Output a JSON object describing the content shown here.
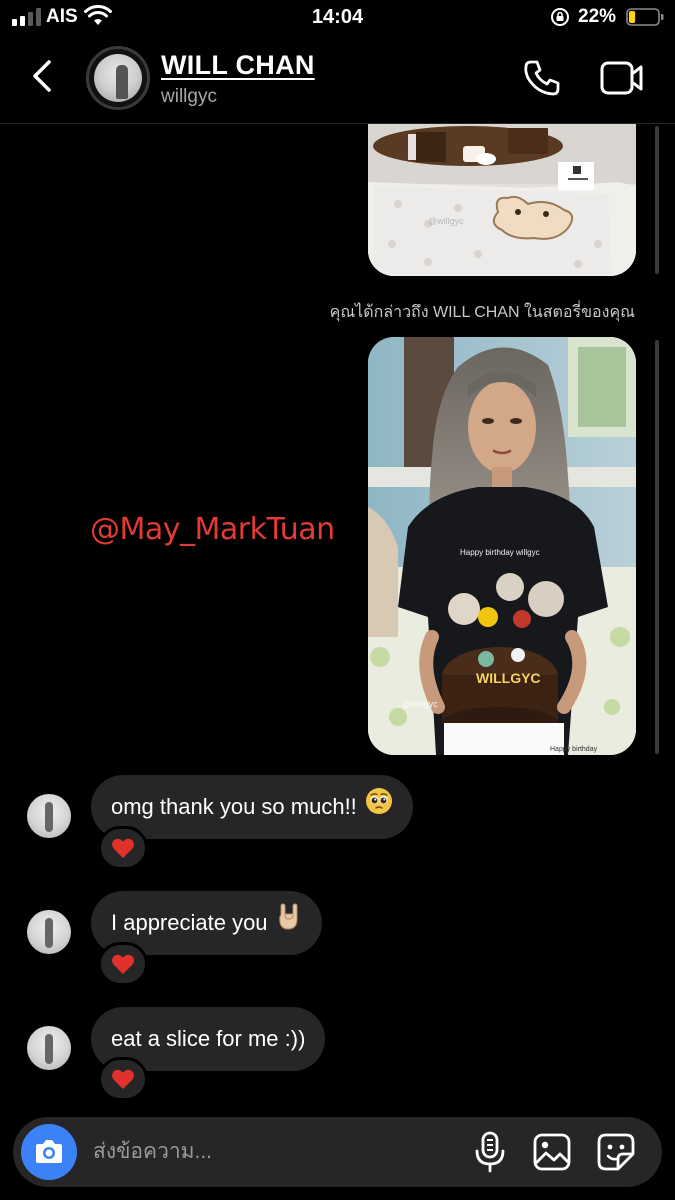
{
  "status_bar": {
    "carrier": "AIS",
    "time": "14:04",
    "battery_percent": "22%",
    "battery_level": 0.22
  },
  "header": {
    "name": "WILL CHAN",
    "username": "willgyc"
  },
  "media": {
    "top_image_caption": "@willgyc",
    "story_mention": "คุณได้กล่าวถึง WILL CHAN ในสตอรี่ของคุณ",
    "main_image_shirt_text": "Happy birthday willgyc",
    "main_image_caption": "@willgyc",
    "main_image_card_text": "Happy birthday"
  },
  "watermark": "@May_MarkTuan",
  "messages": [
    {
      "text": "omg thank you so much!!",
      "emoji": "pleading-face",
      "reaction": "red-heart"
    },
    {
      "text": "I appreciate you",
      "emoji": "sign-of-the-horns",
      "reaction": "red-heart"
    },
    {
      "text": "eat a slice for me :))",
      "emoji": "",
      "reaction": "red-heart"
    }
  ],
  "composer": {
    "placeholder": "ส่งข้อความ..."
  },
  "colors": {
    "background": "#000000",
    "bubble": "#262626",
    "accent_blue": "#3b82f6",
    "heart_red": "#e0312b",
    "watermark_red": "#e23b35"
  }
}
